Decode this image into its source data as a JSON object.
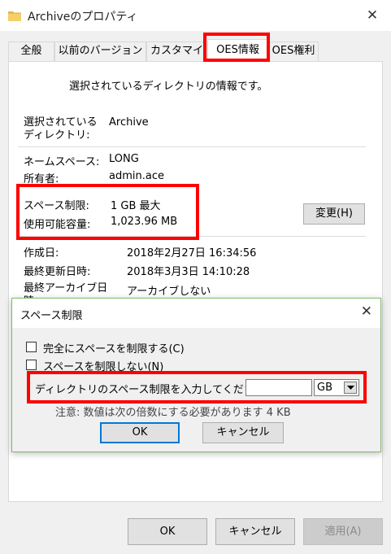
{
  "window": {
    "title": "Archiveのプロパティ",
    "close_glyph": "✕"
  },
  "tabs": [
    {
      "label": "全般"
    },
    {
      "label": "以前のバージョン"
    },
    {
      "label": "カスタマイズ"
    },
    {
      "label": "OES情報"
    },
    {
      "label": "OES権利"
    }
  ],
  "panel": {
    "description": "選択されているディレクトリの情報です。",
    "selected_dir_label": "選択されている\nディレクトリ:",
    "selected_dir_value": "Archive",
    "namespace_label": "ネームスペース:",
    "namespace_value": "LONG",
    "owner_label": "所有者:",
    "owner_value": "admin.ace",
    "space_limit_label": "スペース制限:",
    "space_limit_value": "1 GB 最大",
    "available_label": "使用可能容量:",
    "available_value": "1,023.96 MB",
    "change_button": "変更(H)",
    "created_label": "作成日:",
    "created_value": "2018年2月27日 16:34:56",
    "modified_label": "最終更新日時:",
    "modified_value": "2018年3月3日 14:10:28",
    "archive_label": "最終アーカイブ日時:",
    "archive_value": "アーカイブしない"
  },
  "dialog": {
    "title": "スペース制限",
    "close_glyph": "✕",
    "option_limit_all": "完全にスペースを制限する(C)",
    "option_no_limit": "スペースを制限しない(N)",
    "input_label": "ディレクトリのスペース制限を入力してください",
    "input_value": "",
    "unit_selected": "GB",
    "note": "注意: 数値は次の倍数にする必要があります 4 KB",
    "ok": "OK",
    "cancel": "キャンセル"
  },
  "footer": {
    "ok": "OK",
    "cancel": "キャンセル",
    "apply": "適用(A)"
  },
  "colors": {
    "highlight_red": "#ff0000",
    "dialog_border": "#7fb96a",
    "default_button_border": "#0078d7"
  }
}
